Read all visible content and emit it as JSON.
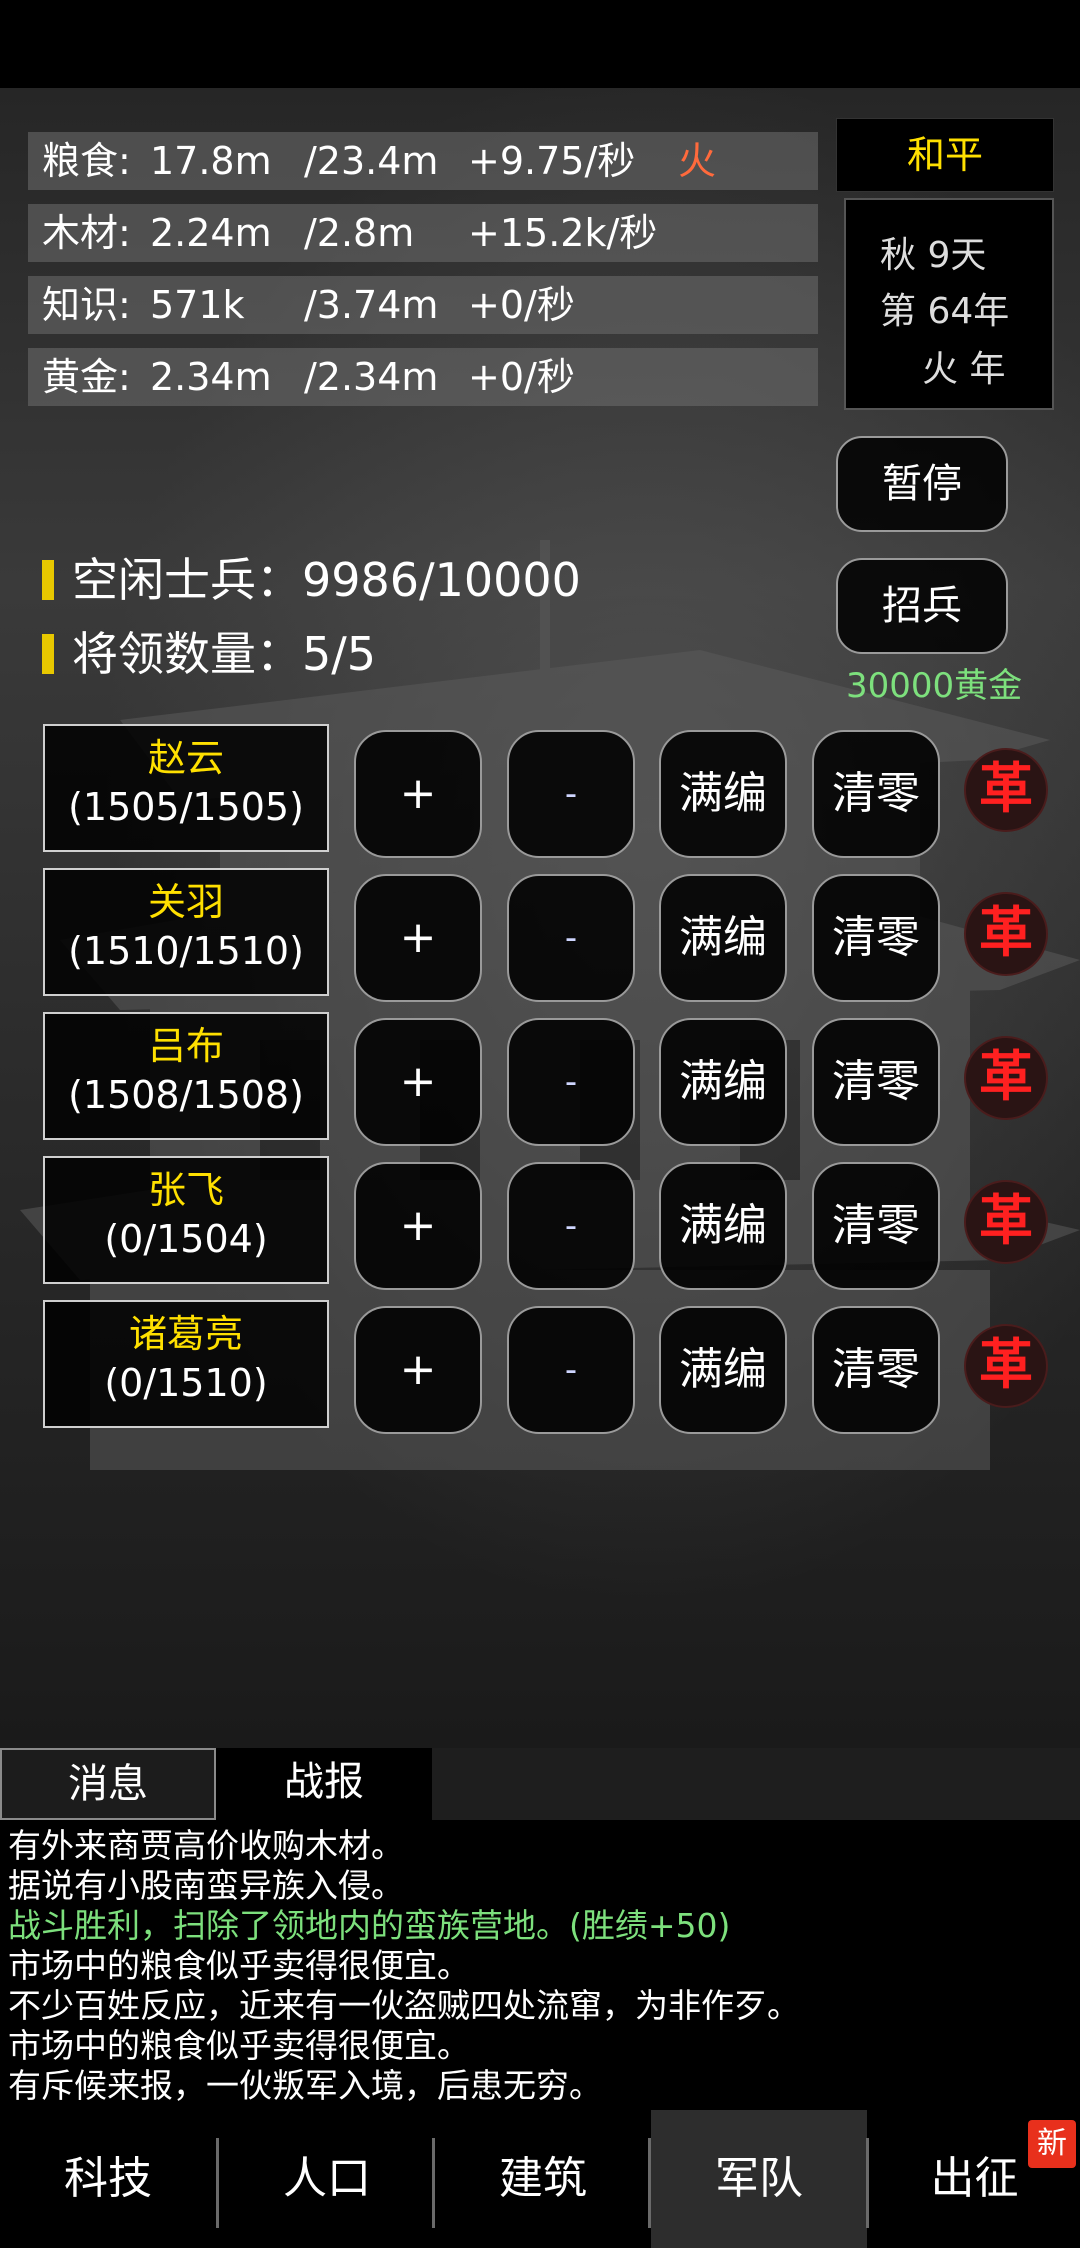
{
  "resources": [
    {
      "name": "粮食:",
      "current": "17.8m",
      "max": "/23.4m",
      "rate": "+9.75/秒",
      "tag": "火"
    },
    {
      "name": "木材:",
      "current": "2.24m",
      "max": "/2.8m",
      "rate": "+15.2k/秒",
      "tag": ""
    },
    {
      "name": "知识:",
      "current": "571k",
      "max": "/3.74m",
      "rate": "+0/秒",
      "tag": ""
    },
    {
      "name": "黄金:",
      "current": "2.34m",
      "max": "/2.34m",
      "rate": "+0/秒",
      "tag": ""
    }
  ],
  "status": {
    "peace": "和平",
    "season": "秋 9天",
    "year": "第 64年",
    "element_year": "火 年"
  },
  "controls": {
    "pause_label": "暂停",
    "recruit_label": "招兵",
    "recruit_cost": "30000黄金"
  },
  "army": {
    "idle_soldiers": "空闲士兵：9986/10000",
    "general_count": "将领数量：5/5"
  },
  "generals": [
    {
      "name": "赵云",
      "count": "(1505/1505)"
    },
    {
      "name": "关羽",
      "count": "(1510/1510)"
    },
    {
      "name": "吕布",
      "count": "(1508/1508)"
    },
    {
      "name": "张飞",
      "count": "(0/1504)"
    },
    {
      "name": "诸葛亮",
      "count": "(0/1510)"
    }
  ],
  "general_buttons": {
    "plus": "+",
    "minus": "-",
    "full": "满编",
    "clear": "清零",
    "dismiss": "革"
  },
  "log_tabs": {
    "messages": "消息",
    "reports": "战报"
  },
  "log": [
    {
      "text": "有外来商贾高价收购木材。",
      "color": "#ffffff"
    },
    {
      "text": "据说有小股南蛮异族入侵。",
      "color": "#ffffff"
    },
    {
      "text": "战斗胜利，扫除了领地内的蛮族营地。(胜绩+50)",
      "color": "#7de07d"
    },
    {
      "text": "市场中的粮食似乎卖得很便宜。",
      "color": "#ffffff"
    },
    {
      "text": "不少百姓反应，近来有一伙盗贼四处流窜，为非作歹。",
      "color": "#ffffff"
    },
    {
      "text": "市场中的粮食似乎卖得很便宜。",
      "color": "#ffffff"
    },
    {
      "text": "有斥候来报，一伙叛军入境，后患无穷。",
      "color": "#ffffff"
    }
  ],
  "nav": [
    {
      "label": "科技",
      "active": false
    },
    {
      "label": "人口",
      "active": false
    },
    {
      "label": "建筑",
      "active": false
    },
    {
      "label": "军队",
      "active": true
    },
    {
      "label": "出征",
      "active": false
    }
  ],
  "nav_badge": "新"
}
